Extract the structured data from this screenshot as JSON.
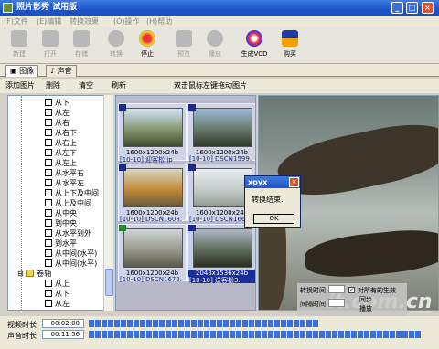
{
  "window": {
    "title": "照片影秀  试用版",
    "min": "_",
    "max": "□",
    "close": "×"
  },
  "menu": [
    "(F)文件",
    "(E)编辑",
    "转换效果",
    "(O)操作",
    "(H)帮助"
  ],
  "toolbar": [
    {
      "label": "新建",
      "icon": "new-icon"
    },
    {
      "label": "打开",
      "icon": "open-icon"
    },
    {
      "label": "存储",
      "icon": "save-icon"
    },
    {
      "label": "转换",
      "icon": "convert-icon"
    },
    {
      "label": "停止",
      "icon": "stop-icon"
    },
    {
      "label": "预览",
      "icon": "preview-icon"
    },
    {
      "label": "播放",
      "icon": "play-icon"
    },
    {
      "label": "生成VCD",
      "icon": "vcd-icon"
    },
    {
      "label": "购买",
      "icon": "buy-icon"
    }
  ],
  "tabs": [
    {
      "label": "图像",
      "icon": "image-tab-icon"
    },
    {
      "label": "声音",
      "icon": "music-tab-icon"
    }
  ],
  "actions": {
    "add": "添加图片",
    "delete": "删除",
    "clear": "清空",
    "refresh": "刷新",
    "hint": "双击鼠标左键拖动图片"
  },
  "tree": [
    "从下",
    "从左",
    "从右",
    "从右下",
    "从右上",
    "从左下",
    "从左上",
    "从水平右",
    "从水平左",
    "从上下及中间",
    "从上及中间",
    "从中央",
    "到中央",
    "从水平到外",
    "到水平",
    "从中间(水平)",
    "从中间(水平)",
    "卷轴",
    "从上",
    "从下",
    "从左"
  ],
  "gallery": [
    {
      "res": "1600x1200x24b",
      "file": "[10-10] 迎客松.jp"
    },
    {
      "res": "1600x1200x24b",
      "file": "[10-10] DSCN1599."
    },
    {
      "res": "1600x1200x24b",
      "file": "[10-10] DSCN1608."
    },
    {
      "res": "1600x1200x24b",
      "file": "[10-10] DSCN1663."
    },
    {
      "res": "1600x1200x24b",
      "file": "[10-10] DSCN1672."
    },
    {
      "res": "2048x1536x24b",
      "file": "[10-10] 送客松3."
    }
  ],
  "dialog": {
    "title": "xpyx",
    "message": "转换结束.",
    "ok": "OK",
    "close": "×"
  },
  "controls": {
    "switch_time": "转换时间",
    "interval_time": "间隔时间",
    "all_effect": "对所有的生效",
    "sync": "同步",
    "play": "播放"
  },
  "status": {
    "video_label": "视频时长",
    "video_value": "00:02:00",
    "audio_label": "声音时长",
    "audio_value": "00:11:56"
  },
  "watermark": "it.com.cn",
  "colors": {
    "titlebar": "#1f55c9",
    "selection": "#1a2e9a",
    "progress": "#3a6fd8"
  }
}
